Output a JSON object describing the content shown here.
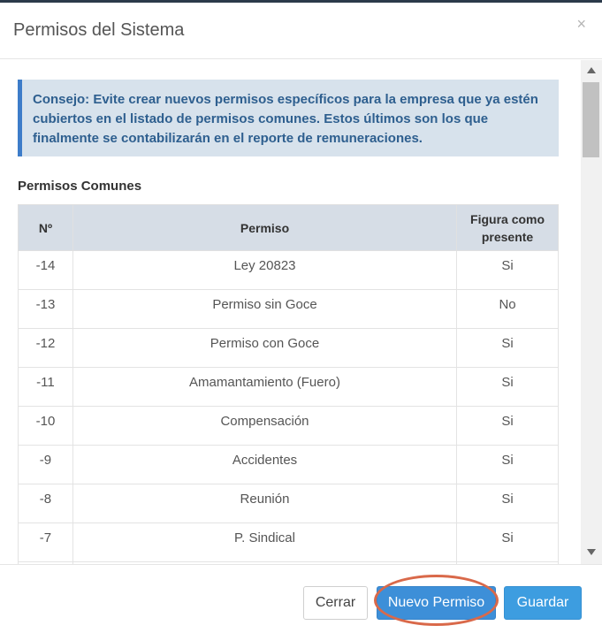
{
  "modal": {
    "title": "Permisos del Sistema",
    "close_symbol": "×"
  },
  "alert": {
    "text": "Consejo: Evite crear nuevos permisos específicos para la empresa que ya estén cubiertos en el listado de permisos comunes. Estos últimos son los que finalmente se contabilizarán en el reporte de remuneraciones."
  },
  "section": {
    "title": "Permisos Comunes"
  },
  "table": {
    "headers": [
      "Nº",
      "Permiso",
      "Figura como presente"
    ],
    "rows": [
      {
        "num": "-14",
        "permiso": "Ley 20823",
        "presente": "Si"
      },
      {
        "num": "-13",
        "permiso": "Permiso sin Goce",
        "presente": "No"
      },
      {
        "num": "-12",
        "permiso": "Permiso con Goce",
        "presente": "Si"
      },
      {
        "num": "-11",
        "permiso": "Amamantamiento (Fuero)",
        "presente": "Si"
      },
      {
        "num": "-10",
        "permiso": "Compensación",
        "presente": "Si"
      },
      {
        "num": "-9",
        "permiso": "Accidentes",
        "presente": "Si"
      },
      {
        "num": "-8",
        "permiso": "Reunión",
        "presente": "Si"
      },
      {
        "num": "-7",
        "permiso": "P. Sindical",
        "presente": "Si"
      },
      {
        "num": "",
        "permiso": "",
        "presente": ""
      }
    ]
  },
  "footer": {
    "close_label": "Cerrar",
    "new_label": "Nuevo Permiso",
    "save_label": "Guardar"
  },
  "colors": {
    "alert_bg": "#d7e2ec",
    "alert_text": "#2e5f8f",
    "primary": "#3d8fd8",
    "highlight": "#d9694a"
  }
}
